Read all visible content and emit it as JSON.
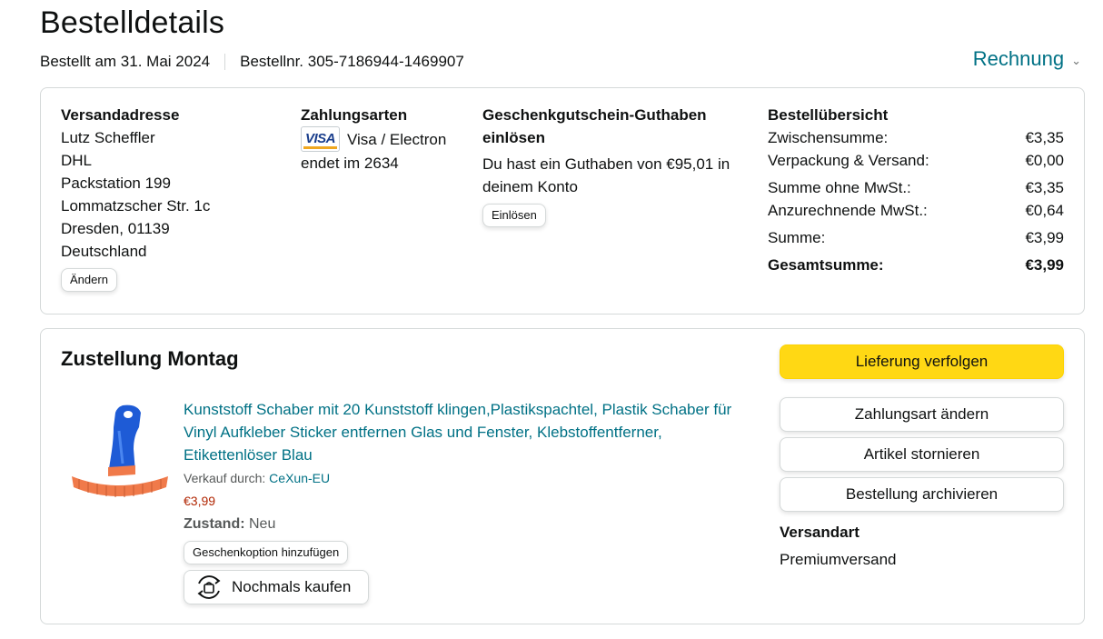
{
  "header": {
    "title": "Bestelldetails",
    "ordered": "Bestellt am 31. Mai 2024",
    "order_number": "Bestellnr. 305-7186944-1469907",
    "invoice_label": "Rechnung"
  },
  "address": {
    "heading": "Versandadresse",
    "lines": [
      "Lutz Scheffler",
      "DHL",
      "Packstation 199",
      "Lommatzscher Str. 1c",
      "Dresden, 01139",
      "Deutschland"
    ],
    "change_label": "Ändern"
  },
  "payment": {
    "heading": "Zahlungsarten",
    "card_brand": "VISA",
    "card_name": "Visa / Electron",
    "ending": "endet im 2634"
  },
  "gift": {
    "heading": "Geschenkgutschein-Guthaben einlösen",
    "balance_text": "Du hast ein Guthaben von €95,01 in deinem Konto",
    "redeem_label": "Einlösen"
  },
  "summary": {
    "heading": "Bestellübersicht",
    "rows": [
      {
        "label": "Zwischensumme:",
        "value": "€3,35"
      },
      {
        "label": "Verpackung & Versand:",
        "value": "€0,00"
      },
      {
        "label": "Summe ohne MwSt.:",
        "value": "€3,35"
      },
      {
        "label": "Anzurechnende MwSt.:",
        "value": "€0,64"
      },
      {
        "label": "Summe:",
        "value": "€3,99"
      },
      {
        "label": "Gesamtsumme:",
        "value": "€3,99"
      }
    ]
  },
  "delivery": {
    "title": "Zustellung Montag",
    "product_title": "Kunststoff Schaber mit 20 Kunststoff klingen,Plastikspachtel, Plastik Schaber für Vinyl Aufkleber Sticker entfernen Glas und Fenster, Klebstoffentferner, Etikettenlöser Blau",
    "sold_by_label": "Verkauf durch:",
    "seller": "CeXun-EU",
    "price": "€3,99",
    "condition_label": "Zustand:",
    "condition": "Neu",
    "gift_option_label": "Geschenkoption hinzufügen",
    "buy_again_label": "Nochmals kaufen"
  },
  "actions": {
    "track": "Lieferung verfolgen",
    "change_payment": "Zahlungsart ändern",
    "cancel": "Artikel stornieren",
    "archive": "Bestellung archivieren",
    "shipping_heading": "Versandart",
    "shipping_value": "Premiumversand"
  },
  "colors": {
    "link": "#007185",
    "primary_button": "#ffd814",
    "price": "#b12704"
  }
}
